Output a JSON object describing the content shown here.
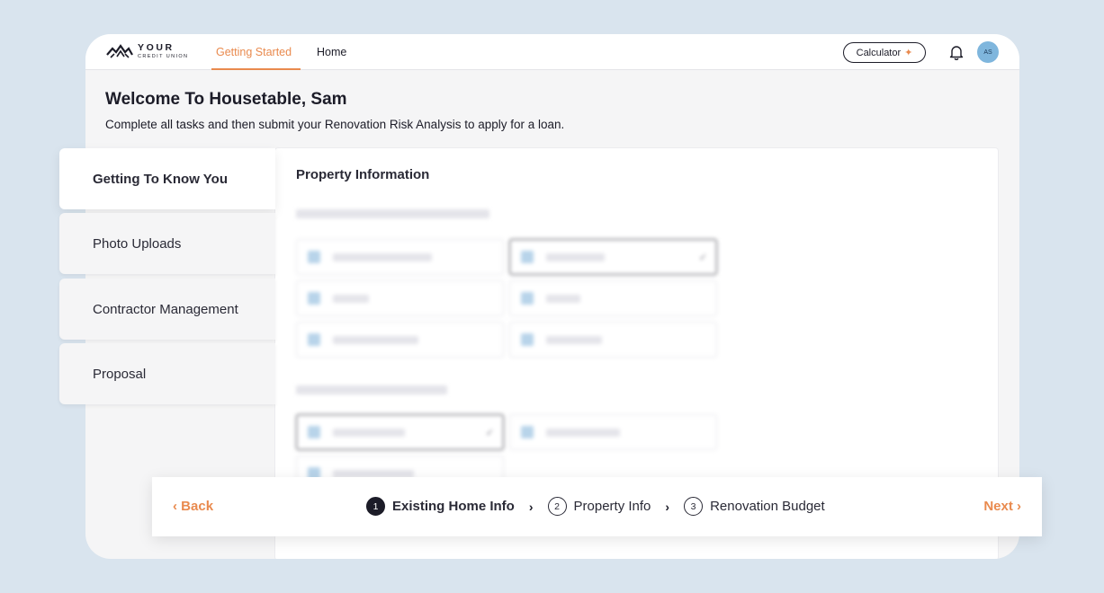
{
  "brand": {
    "line1": "YOUR",
    "line2": "CREDIT UNION"
  },
  "nav": [
    {
      "label": "Getting Started"
    },
    {
      "label": "Home"
    }
  ],
  "header": {
    "calculator_label": "Calculator",
    "avatar_initials": "AS"
  },
  "welcome": {
    "title": "Welcome To Housetable, Sam",
    "subtitle": "Complete all tasks and then submit your Renovation Risk Analysis to apply for a loan."
  },
  "sidebar": {
    "items": [
      {
        "label": "Getting To Know You"
      },
      {
        "label": "Photo Uploads"
      },
      {
        "label": "Contractor Management"
      },
      {
        "label": "Proposal"
      }
    ]
  },
  "panel": {
    "title": "Property Information"
  },
  "steps": [
    {
      "num": "1",
      "label": "Existing Home Info"
    },
    {
      "num": "2",
      "label": "Property Info"
    },
    {
      "num": "3",
      "label": "Renovation Budget"
    }
  ],
  "footer": {
    "back_label": "Back",
    "next_label": "Next"
  },
  "colors": {
    "accent": "#e98a4e",
    "background": "#d9e4ee",
    "avatar": "#7fb6dd"
  }
}
